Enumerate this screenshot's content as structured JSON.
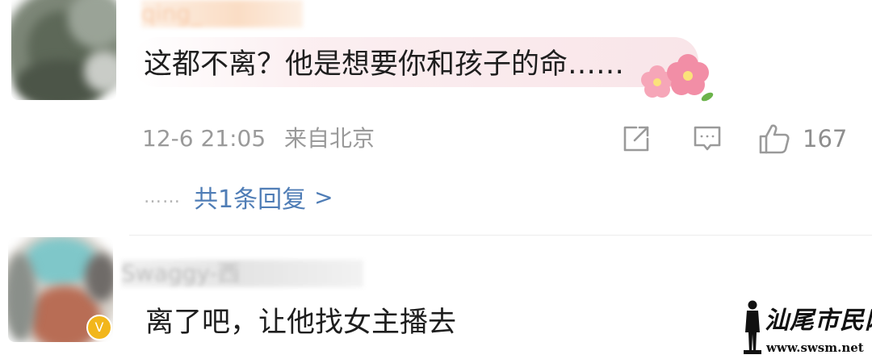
{
  "comments": [
    {
      "username": "qing_",
      "text": "这都不离？他是想要你和孩子的命……",
      "emoji": "flower-emoji",
      "timestamp": "12-6 21:05",
      "location": "来自北京",
      "actions": {
        "share_icon": "share-icon",
        "comment_icon": "comment-icon",
        "like_icon": "thumbs-up-icon",
        "like_count": "167"
      },
      "replies": {
        "dots": "……",
        "label": "共1条回复",
        "chevron": ">"
      }
    },
    {
      "username": "Swaggy-西",
      "text": "离了吧，让他找女主播去",
      "badge": "V"
    }
  ],
  "watermark": {
    "title": "汕尾市民网",
    "url": "www.swsm.net"
  },
  "colors": {
    "link": "#4f7db6",
    "meta": "#9a9a9a",
    "text": "#1e1e1e",
    "highlight": "#f8e4e8",
    "badge": "#f2b61b"
  }
}
